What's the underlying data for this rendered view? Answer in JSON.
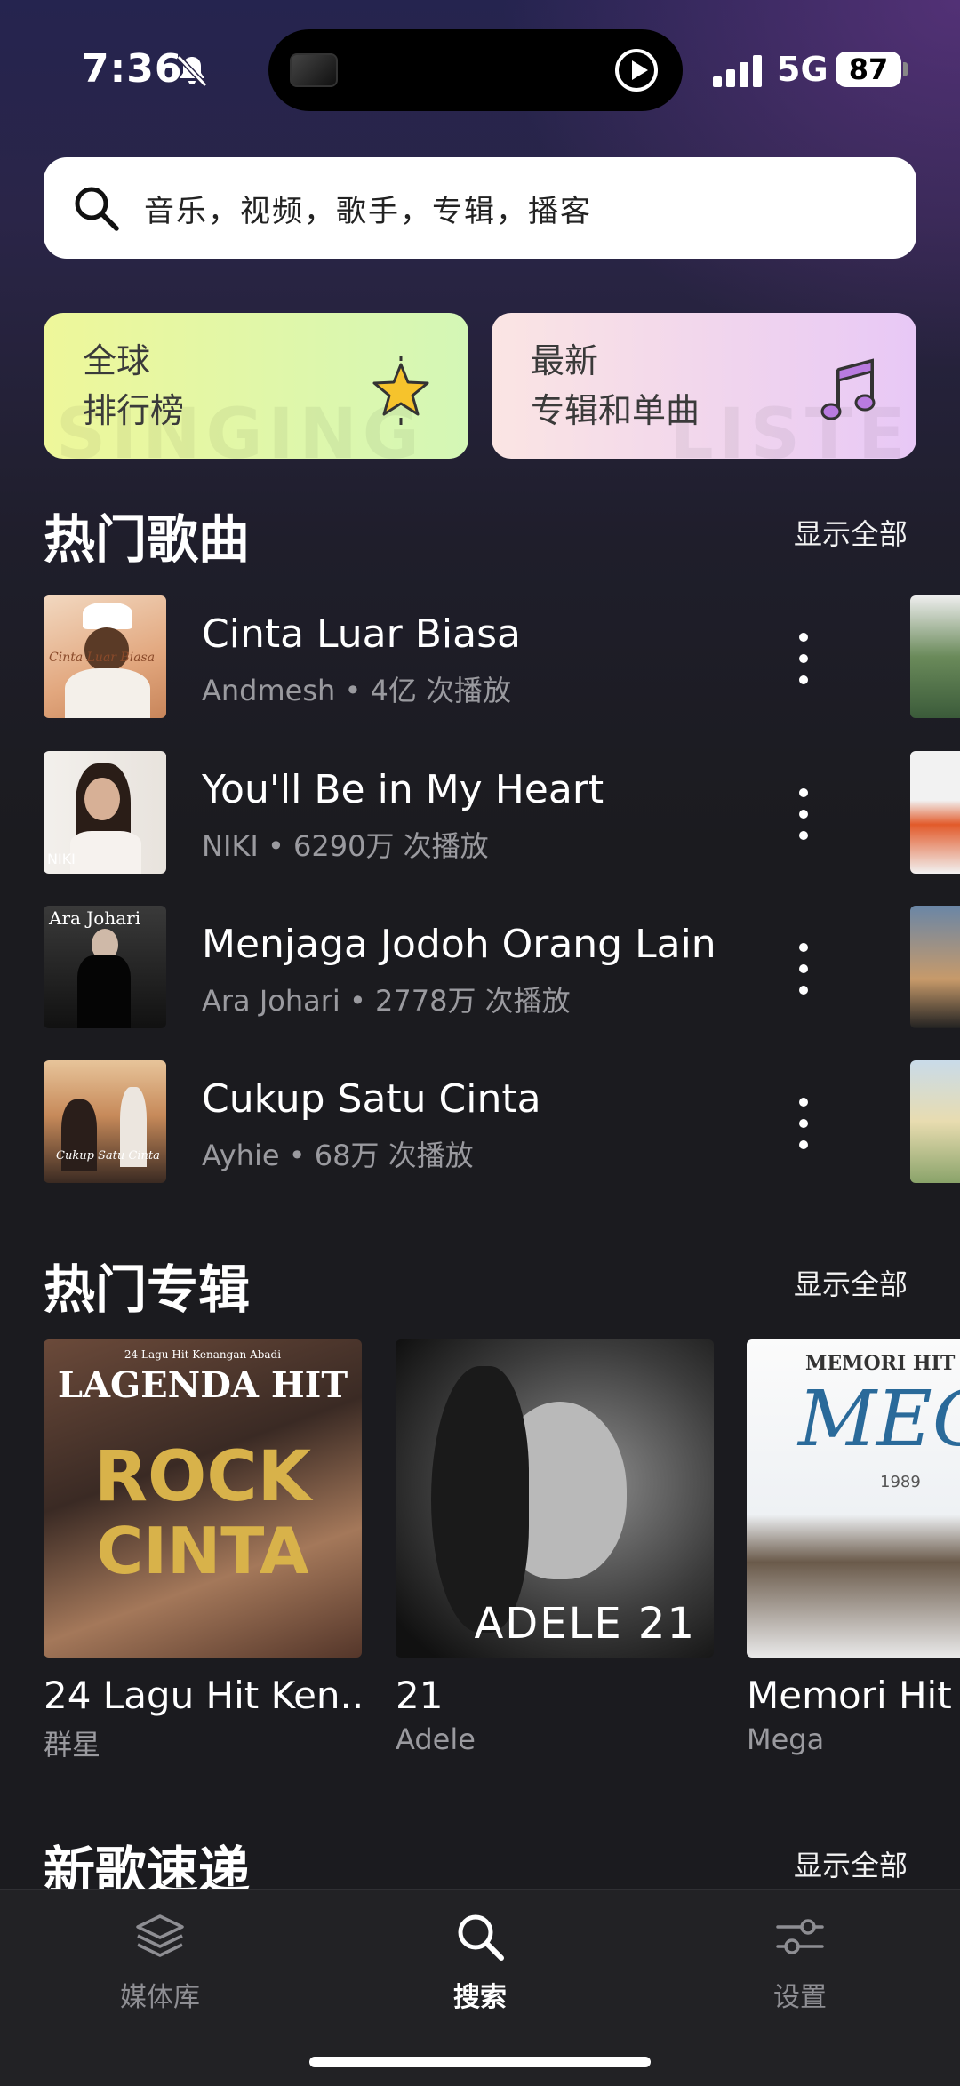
{
  "status_bar": {
    "time": "7:36",
    "network": "5G",
    "battery": "87"
  },
  "search": {
    "placeholder": "音乐，视频，歌手，专辑，播客"
  },
  "cards": {
    "charts": {
      "line1": "全球",
      "line2": "排行榜",
      "icon": "star-icon",
      "watermark": "SINGING"
    },
    "new_releases": {
      "line1": "最新",
      "line2": "专辑和单曲",
      "icon": "music-note-icon",
      "watermark": "LISTENI"
    }
  },
  "hot_songs": {
    "title": "热门歌曲",
    "show_all": "显示全部",
    "items": [
      {
        "title": "Cinta Luar Biasa",
        "artist": "Andmesh",
        "plays": "4亿 次播放"
      },
      {
        "title": "You'll Be in My Heart",
        "artist": "NIKI",
        "plays": "6290万 次播放"
      },
      {
        "title": "Menjaga Jodoh Orang Lain",
        "artist": "Ara Johari",
        "plays": "2778万 次播放"
      },
      {
        "title": "Cukup Satu Cinta",
        "artist": "Ayhie",
        "plays": "68万 次播放"
      }
    ]
  },
  "hot_albums": {
    "title": "热门专辑",
    "show_all": "显示全部",
    "items": [
      {
        "title": "24 Lagu Hit Ken...",
        "artist": "群星",
        "cover_text": [
          "24 Lagu Hit Kenangan Abadi",
          "LAGENDA HIT",
          "ROCK",
          "CINTA"
        ]
      },
      {
        "title": "21",
        "artist": "Adele",
        "cover_text": [
          "ADELE 21"
        ]
      },
      {
        "title": "Memori Hit",
        "artist": "Mega",
        "cover_text": [
          "MEMORI HIT",
          "MEG",
          "1989"
        ]
      }
    ]
  },
  "new_songs": {
    "title": "新歌速递",
    "show_all": "显示全部"
  },
  "cover_text": {
    "song1": "Cinta Luar Biasa",
    "song2": "NIKI",
    "song3": "Ara Johari",
    "song4": "Cukup Satu Cinta"
  },
  "tabbar": {
    "library": "媒体库",
    "search": "搜索",
    "settings": "设置"
  },
  "colors": {
    "accent": "#ffffff",
    "muted": "#9a9a9f",
    "background": "#1b1b1f"
  }
}
